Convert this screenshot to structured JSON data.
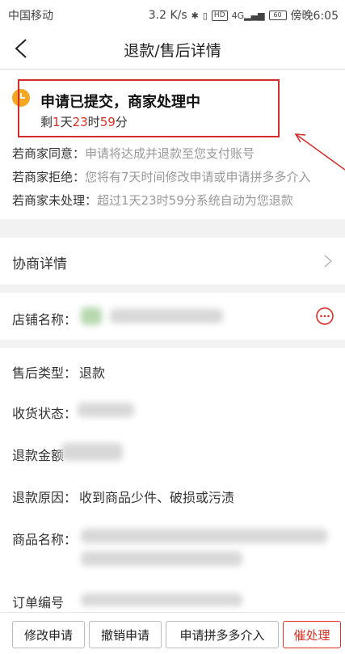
{
  "status_bar": {
    "carrier": "中国移动",
    "speed": "3.2 K/s",
    "icons": [
      "bluetooth-icon",
      "vibrate-icon",
      "hd-icon",
      "4g-signal-icon"
    ],
    "hd": "HD",
    "net": "4G",
    "battery": "60",
    "time": "傍晚6:05"
  },
  "nav": {
    "title": "退款/售后详情"
  },
  "status_card": {
    "title": "申请已提交，商家处理中",
    "countdown": {
      "prefix": "剩",
      "days": "1",
      "days_unit": "天",
      "hours": "23",
      "hours_unit": "时",
      "minutes": "59",
      "minutes_unit": "分"
    },
    "rules": [
      {
        "key": "若商家同意：",
        "value": "申请将达成并退款至您支付账号"
      },
      {
        "key": "若商家拒绝：",
        "value": "您将有7天时间修改申请或申请拼多多介入"
      },
      {
        "key": "若商家未处理：",
        "value": "超过1天23时59分系统自动为您退款"
      }
    ],
    "accent_color": "#e02e24"
  },
  "negotiation": {
    "label": "协商详情"
  },
  "store": {
    "label": "店铺名称："
  },
  "details": {
    "type_label": "售后类型：",
    "type_value": "退款",
    "receipt_label": "收货状态：",
    "amount_label": "退款金额",
    "reason_label": "退款原因：",
    "reason_value": "收到商品少件、破损或污渍",
    "product_label": "商品名称：",
    "order_label": "订单编号"
  },
  "actions": {
    "modify": "修改申请",
    "cancel": "撤销申请",
    "escalate": "申请拼多多介入",
    "urge": "催处理"
  }
}
